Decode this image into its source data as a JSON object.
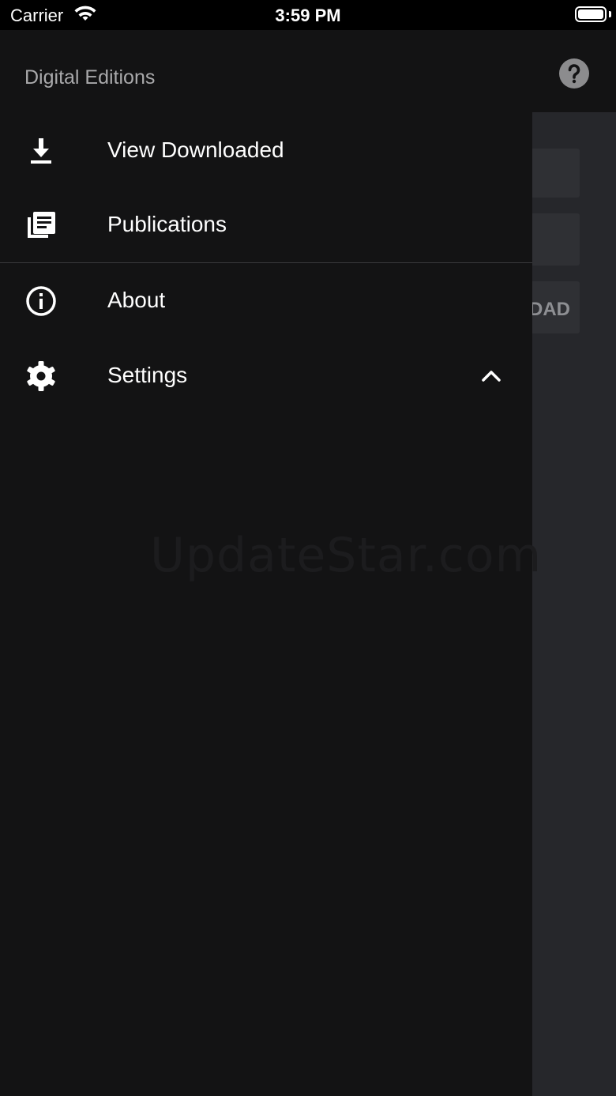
{
  "status_bar": {
    "carrier": "Carrier",
    "time": "3:59 PM"
  },
  "drawer": {
    "title": "Digital Editions",
    "items": [
      {
        "label": "View Downloaded",
        "icon": "download-icon"
      },
      {
        "label": "Publications",
        "icon": "publications-icon"
      },
      {
        "label": "About",
        "icon": "info-icon"
      },
      {
        "label": "Settings",
        "icon": "gear-icon",
        "expand": "chevron-up-icon"
      }
    ]
  },
  "background": {
    "card_3_text": "DAD",
    "help_icon": "help-icon"
  },
  "watermark": "UpdateStar.com",
  "colors": {
    "drawer_bg": "#131314",
    "text": "#ffffff",
    "title": "#a9a9ab"
  }
}
